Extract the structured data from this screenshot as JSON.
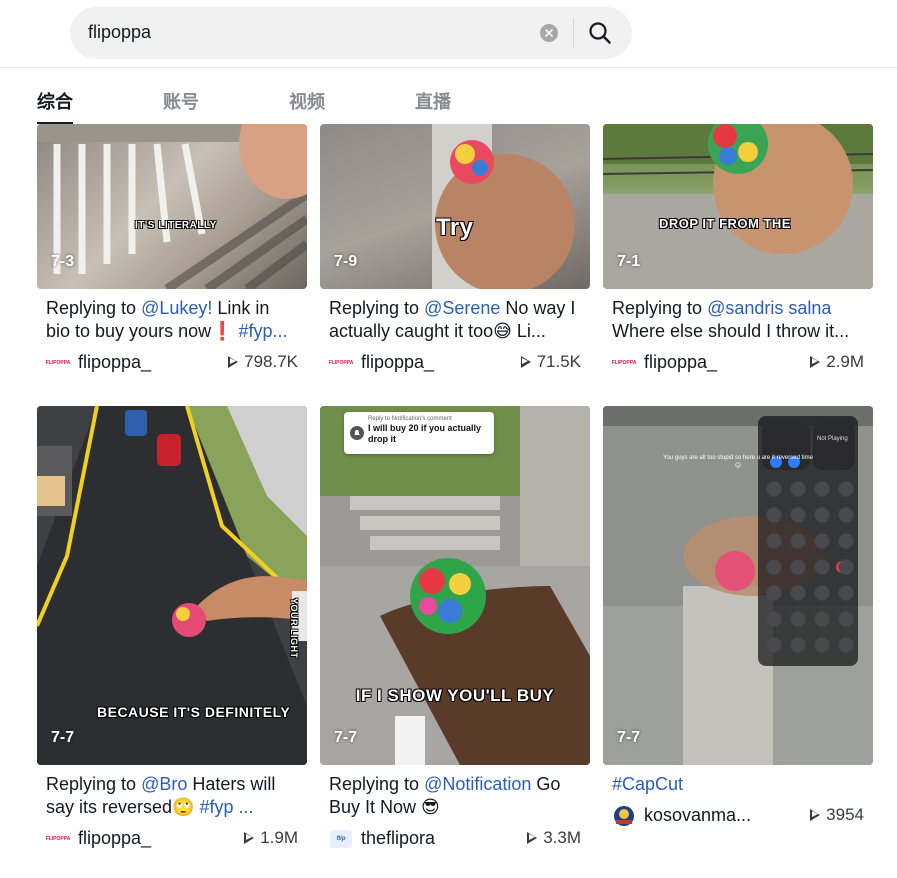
{
  "search": {
    "query": "flipoppa"
  },
  "tabs": [
    {
      "label": "综合"
    },
    {
      "label": "账号"
    },
    {
      "label": "视频"
    },
    {
      "label": "直播"
    }
  ],
  "videos": [
    {
      "badge": "7-3",
      "overlay": "IT'S LITERALLY",
      "desc_prefix": "Replying to ",
      "mention": "@Lukey!",
      "desc_rest": " Link in bio to buy yours now❗ ",
      "hashtag": "#fyp...",
      "author": "flipoppa_",
      "views": "798.7K"
    },
    {
      "badge": "7-9",
      "overlay": "Try",
      "desc_prefix": "Replying to ",
      "mention": "@Serene",
      "desc_rest": " No way I actually caught it too😅 Li...",
      "hashtag": "",
      "author": "flipoppa_",
      "views": "71.5K"
    },
    {
      "badge": "7-1",
      "overlay": "DROP IT FROM THE",
      "desc_prefix": "Replying to ",
      "mention": "@sandris salna",
      "desc_rest": " Where else should I throw it...",
      "hashtag": "",
      "author": "flipoppa_",
      "views": "2.9M"
    },
    {
      "badge": "7-7",
      "overlay": "BECAUSE IT'S DEFINITELY",
      "side_text": "YOUR LIGHT",
      "desc_prefix": "Replying to ",
      "mention": "@Bro",
      "desc_rest": " Haters will say its reversed🙄 ",
      "hashtag": "#fyp ...",
      "author": "flipoppa_",
      "views": "1.9M"
    },
    {
      "badge": "7-7",
      "overlay": "IF I SHOW YOU'LL BUY",
      "comment_header": "Reply to Notification's comment",
      "comment_body": "I will buy 20 if you actually drop it",
      "desc_prefix": "Replying to ",
      "mention": "@Notification",
      "desc_rest": " Go Buy It Now 😎",
      "hashtag": "",
      "author": "theflipora",
      "views": "3.3M"
    },
    {
      "badge": "7-7",
      "overlay": "You guys are all too stupid so here u are it reversed time😊",
      "cc_label": "Not Playing",
      "desc_prefix": "",
      "mention": "",
      "desc_rest": "",
      "hashtag": "#CapCut",
      "author": "kosovanma...",
      "views": "3954"
    }
  ],
  "colors": {
    "link": "#2b5db9",
    "text": "#161823",
    "muted": "#8a8b91"
  }
}
